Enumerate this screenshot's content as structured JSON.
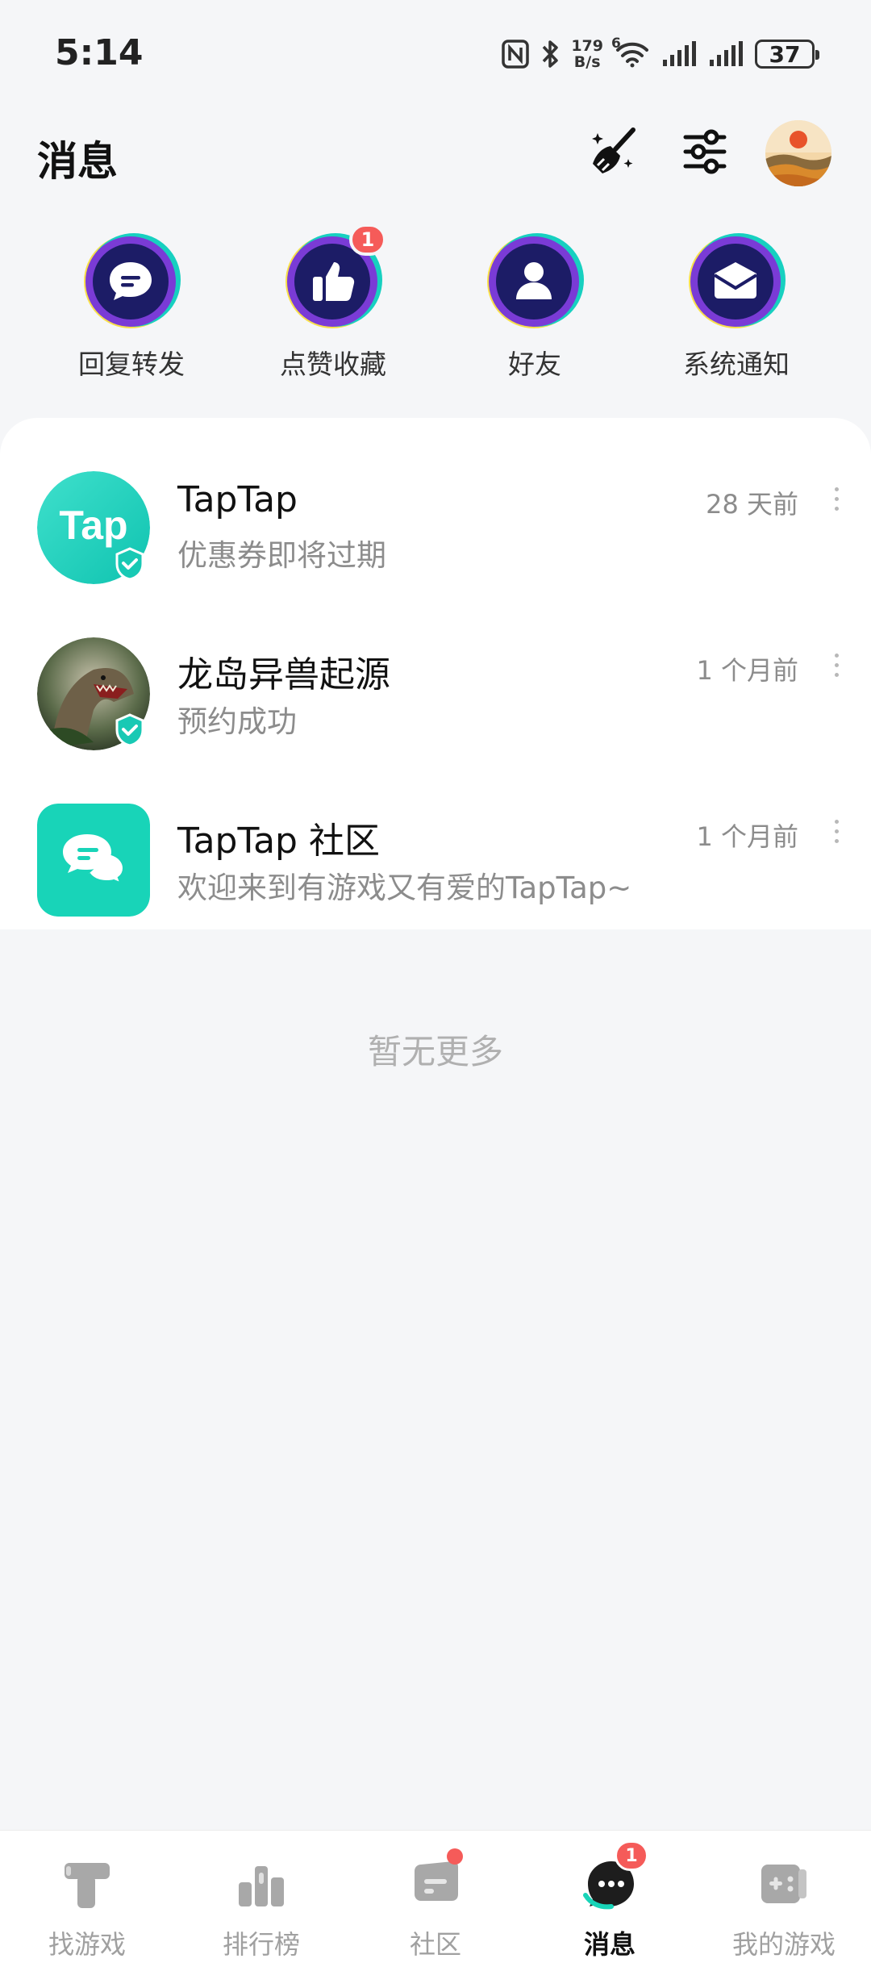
{
  "status_bar": {
    "time": "5:14",
    "net_speed_value": "179",
    "net_speed_unit": "B/s",
    "wifi_label": "6",
    "battery": "37",
    "icons": [
      "nfc-icon",
      "bluetooth-icon",
      "wifi-icon",
      "signal-icon",
      "signal-icon",
      "battery-icon"
    ]
  },
  "header": {
    "title": "消息",
    "icons": [
      "clean-broom-icon",
      "settings-sliders-icon",
      "avatar"
    ]
  },
  "categories": [
    {
      "label": "回复转发",
      "icon": "reply-bubble-icon",
      "badge": ""
    },
    {
      "label": "点赞收藏",
      "icon": "thumbs-up-icon",
      "badge": "1"
    },
    {
      "label": "好友",
      "icon": "friend-person-icon",
      "badge": ""
    },
    {
      "label": "系统通知",
      "icon": "envelope-icon",
      "badge": ""
    }
  ],
  "messages": [
    {
      "name": "TapTap",
      "text": "优惠券即将过期",
      "time": "28 天前",
      "avatar_text": "Tap"
    },
    {
      "name": "龙岛异兽起源",
      "text": "预约成功",
      "time": "1 个月前"
    },
    {
      "name": "TapTap 社区",
      "text": "欢迎来到有游戏又有爱的TapTap~",
      "time": "1 个月前"
    }
  ],
  "no_more_text": "暂无更多",
  "bottom_nav": [
    {
      "label": "找游戏",
      "icon": "find-games-icon",
      "active": false
    },
    {
      "label": "排行榜",
      "icon": "ranking-icon",
      "active": false
    },
    {
      "label": "社区",
      "icon": "community-icon",
      "active": false,
      "dot": true
    },
    {
      "label": "消息",
      "icon": "messages-icon",
      "active": true,
      "badge": "1"
    },
    {
      "label": "我的游戏",
      "icon": "my-games-icon",
      "active": false
    }
  ],
  "colors": {
    "accent_teal": "#18d4b8",
    "badge_red": "#f55b59",
    "icon_navy": "#1c1c66",
    "muted_text": "#8c8c8c"
  }
}
